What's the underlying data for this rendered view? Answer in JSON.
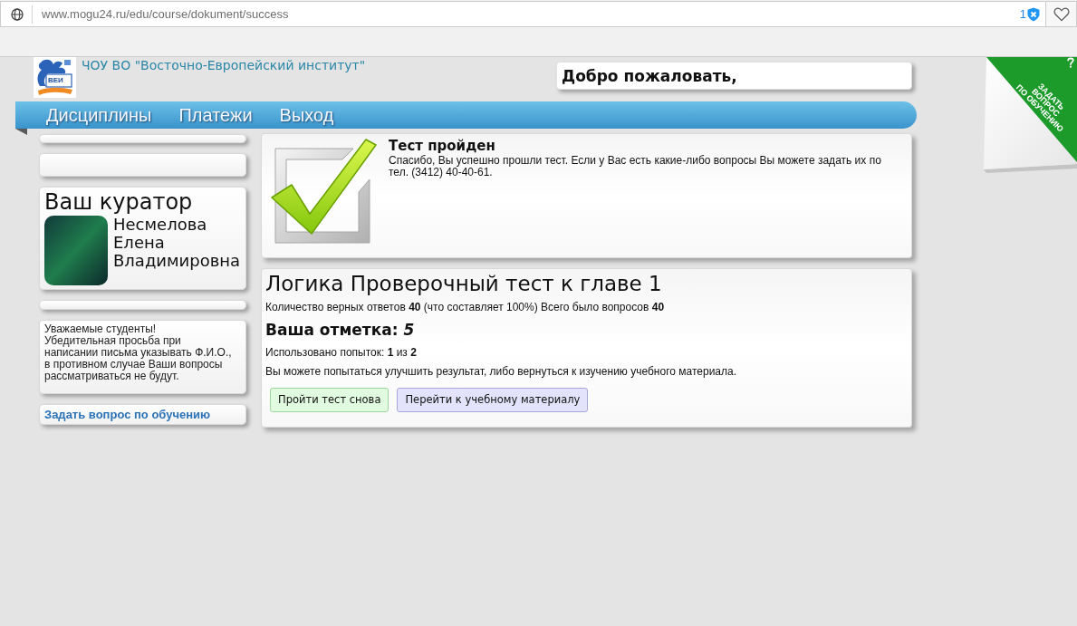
{
  "browser": {
    "url": "www.mogu24.ru/edu/course/dokument/success",
    "badge_count": "1"
  },
  "header": {
    "logo_text": "ВЕИ",
    "institution": "ЧОУ ВО \"Восточно-Европейский институт\"",
    "welcome": "Добро пожаловать,"
  },
  "ribbon": {
    "label": "ЗАДАТЬ\nВОПРОС\nПО ОБУЧЕНИЮ"
  },
  "nav": [
    {
      "label": "Дисциплины"
    },
    {
      "label": "Платежи"
    },
    {
      "label": "Выход"
    }
  ],
  "sidebar": {
    "curator": {
      "heading": "Ваш куратор",
      "name": "Несмелова Елена Владимировна"
    },
    "notice": "Уважаемые студенты!\nУбедительная просьба при\nнаписании письма указывать Ф.И.О.,\nв противном случае Ваши вопросы\nрассматриваться не будут.",
    "question_link": "Задать вопрос по обучению"
  },
  "result_notice": {
    "title": "Тест пройден",
    "message": "Спасибо, Вы успешно прошли тест. Если у Вас есть какие-либо вопросы Вы можете задать их по тел. (3412) 40-40-61."
  },
  "test_result": {
    "title": "Логика Проверочный тест к главе 1",
    "score": "Количество верных ответов **40** (что составляет 100%) Всего было вопросов **40**",
    "grade": "Ваша отметка: *5*",
    "attempts": "Использовано попыток: **1** из **2**",
    "hint": "Вы можете попытаться улучшить результат, либо вернуться к изучению учебного материала.",
    "buttons": [
      {
        "label": "Пройти тест снова",
        "kind": "retry"
      },
      {
        "label": "Перейти к учебному материалу",
        "kind": "material"
      }
    ]
  }
}
